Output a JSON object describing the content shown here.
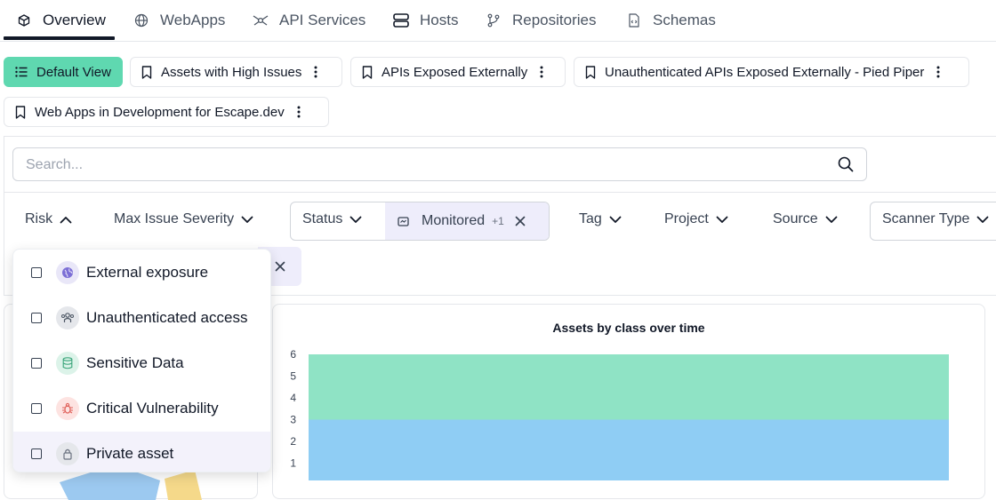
{
  "tabs": [
    {
      "label": "Overview",
      "icon": "cube-icon"
    },
    {
      "label": "WebApps",
      "icon": "globe-icon"
    },
    {
      "label": "API Services",
      "icon": "api-icon"
    },
    {
      "label": "Hosts",
      "icon": "server-icon"
    },
    {
      "label": "Repositories",
      "icon": "git-branch-icon"
    },
    {
      "label": "Schemas",
      "icon": "file-code-icon"
    }
  ],
  "views": [
    {
      "label": "Default View",
      "icon": "list-icon"
    },
    {
      "label": "Assets with High Issues",
      "icon": "bookmark-icon"
    },
    {
      "label": "APIs Exposed Externally",
      "icon": "bookmark-icon"
    },
    {
      "label": "Unauthenticated APIs Exposed Externally - Pied Piper",
      "icon": "bookmark-icon"
    },
    {
      "label": "Web Apps in Development for Escape.dev",
      "icon": "bookmark-icon"
    }
  ],
  "search": {
    "placeholder": "Search..."
  },
  "filters": {
    "risk": "Risk",
    "max_severity": "Max Issue Severity",
    "status": "Status",
    "status_chip": "Monitored",
    "status_chip_extra": "+1",
    "tag": "Tag",
    "project": "Project",
    "source": "Source",
    "scanner_type": "Scanner Type"
  },
  "risk_options": [
    {
      "label": "External exposure",
      "icon": "globe-icon",
      "color": "#7c6fd6",
      "bg": "#e9e7f8"
    },
    {
      "label": "Unauthenticated access",
      "icon": "users-icon",
      "color": "#4b5563",
      "bg": "#e5e7eb"
    },
    {
      "label": "Sensitive Data",
      "icon": "database-icon",
      "color": "#3aa57a",
      "bg": "#dcf3e9"
    },
    {
      "label": "Critical Vulnerability",
      "icon": "bug-icon",
      "color": "#e0615a",
      "bg": "#fde3e1"
    },
    {
      "label": "Private asset",
      "icon": "lock-icon",
      "color": "#6b7280",
      "bg": "#e5e7eb"
    }
  ],
  "chart_data": {
    "type": "area",
    "title": "Assets by class over time",
    "y_ticks": [
      1,
      2,
      3,
      4,
      5,
      6
    ],
    "ylim": [
      0,
      6
    ],
    "series": [
      {
        "values": [
          3,
          3
        ],
        "color": "#8fcdf4"
      },
      {
        "values": [
          3,
          3
        ],
        "color": "#8fe3c5"
      }
    ]
  },
  "colors": {
    "accent": "#5fd8b0",
    "chip_bg": "#eeedfb"
  }
}
